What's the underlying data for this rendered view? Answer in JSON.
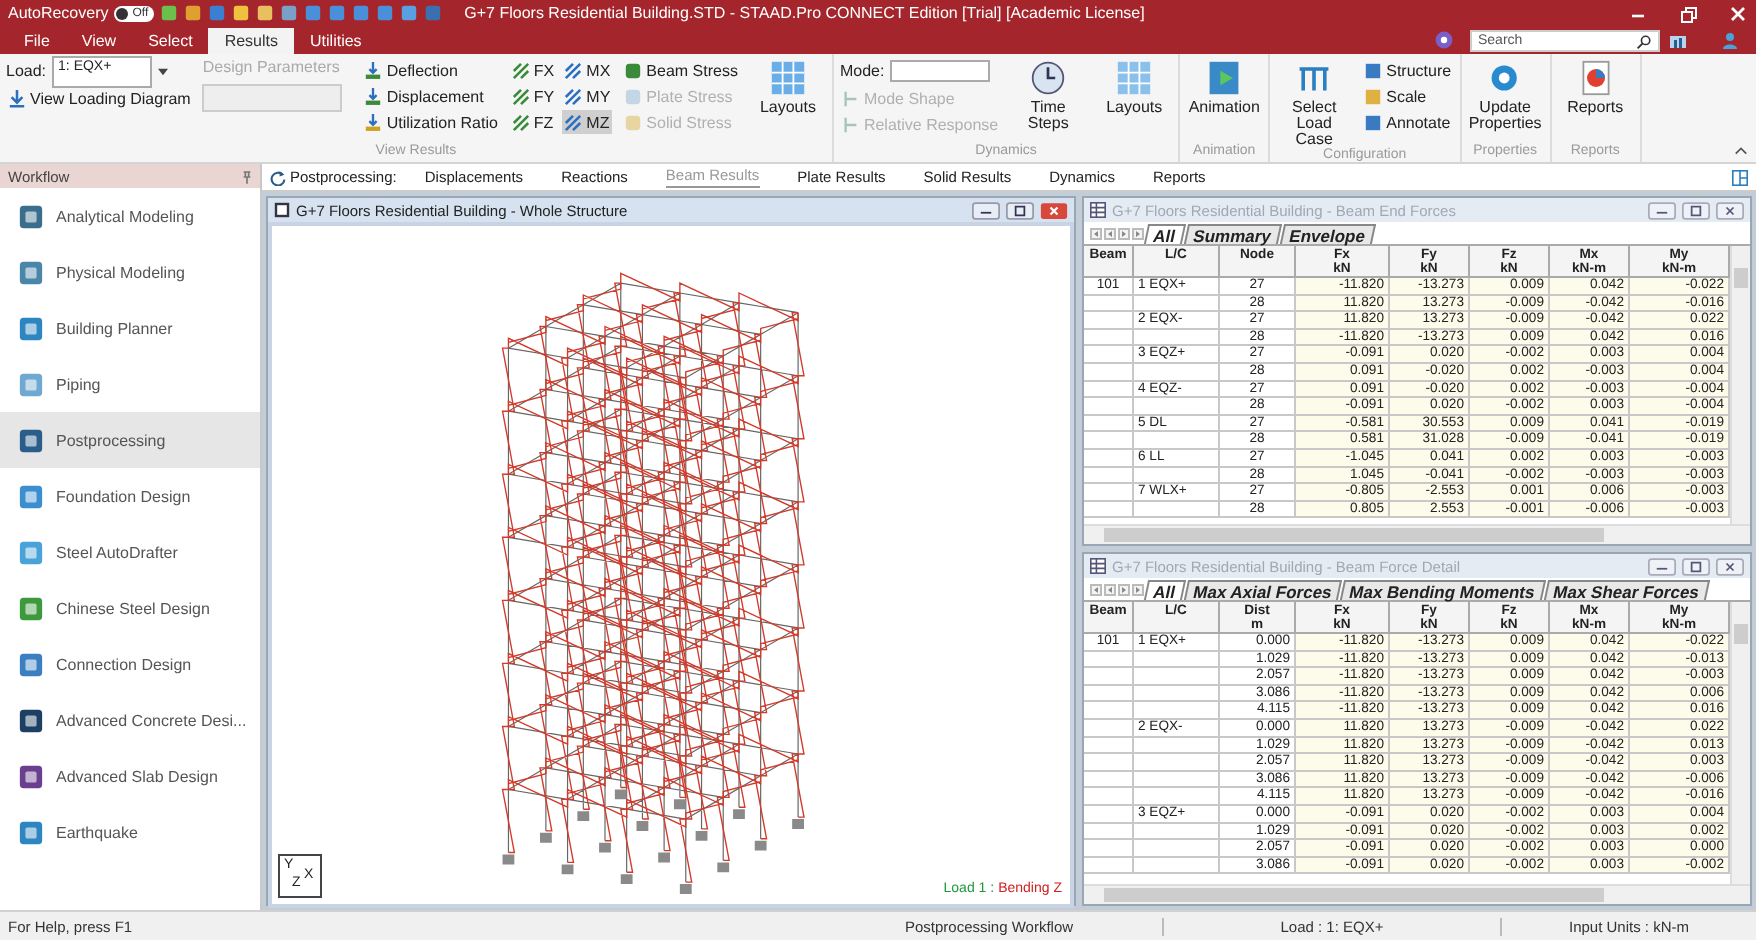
{
  "title_bar": {
    "autorecovery": {
      "label": "AutoRecovery",
      "toggle_text": "Off",
      "on": false
    },
    "title": "G+7 Floors Residential Building.STD - STAAD.Pro CONNECT Edition [Trial] [Academic License]"
  },
  "menu_tabs": [
    {
      "label": "File",
      "selected": false
    },
    {
      "label": "View",
      "selected": false
    },
    {
      "label": "Select",
      "selected": false
    },
    {
      "label": "Results",
      "selected": true
    },
    {
      "label": "Utilities",
      "selected": false
    }
  ],
  "search": {
    "placeholder": "Search"
  },
  "ribbon": {
    "view_results": {
      "label": "View Results",
      "load_label": "Load:",
      "load_value": "1: EQX+",
      "view_loading_diagram": "View Loading Diagram",
      "design_parameters": {
        "label": "Design Parameters",
        "disabled": true
      },
      "result_types": [
        "Deflection",
        "Displacement",
        "Utilization Ratio"
      ],
      "forces": [
        {
          "label": "FX",
          "selected": false
        },
        {
          "label": "MX",
          "selected": false
        },
        {
          "label": "FY",
          "selected": false
        },
        {
          "label": "MY",
          "selected": false
        },
        {
          "label": "FZ",
          "selected": false
        },
        {
          "label": "MZ",
          "selected": true
        }
      ],
      "stresses": [
        {
          "label": "Beam Stress",
          "disabled": false
        },
        {
          "label": "Plate Stress",
          "disabled": true
        },
        {
          "label": "Solid Stress",
          "disabled": true
        }
      ],
      "layouts": "Layouts"
    },
    "dynamics": {
      "label": "Dynamics",
      "mode_label": "Mode:",
      "options": [
        {
          "label": "Mode Shape",
          "disabled": true
        },
        {
          "label": "Relative Response",
          "disabled": true
        }
      ],
      "time_steps": "Time Steps",
      "layouts": "Layouts"
    },
    "animation": {
      "label": "Animation",
      "button": "Animation"
    },
    "configuration": {
      "label": "Configuration",
      "select_load_case": "Select Load Case",
      "items": [
        "Structure",
        "Scale",
        "Annotate"
      ]
    },
    "properties": {
      "label": "Properties",
      "button": "Update Properties"
    },
    "reports": {
      "label": "Reports",
      "button": "Reports"
    }
  },
  "workflow": {
    "title": "Workflow",
    "items": [
      {
        "label": "Analytical Modeling",
        "selected": false,
        "color": "#3a6e8c"
      },
      {
        "label": "Physical Modeling",
        "selected": false,
        "color": "#4a86a8"
      },
      {
        "label": "Building Planner",
        "selected": false,
        "color": "#2e86c1"
      },
      {
        "label": "Piping",
        "selected": false,
        "color": "#6fa8d0"
      },
      {
        "label": "Postprocessing",
        "selected": true,
        "color": "#2a5d8a"
      },
      {
        "label": "Foundation Design",
        "selected": false,
        "color": "#3b8fd0"
      },
      {
        "label": "Steel AutoDrafter",
        "selected": false,
        "color": "#4aa3d8"
      },
      {
        "label": "Chinese Steel Design",
        "selected": false,
        "color": "#3c9a3c"
      },
      {
        "label": "Connection Design",
        "selected": false,
        "color": "#3b7fc0"
      },
      {
        "label": "Advanced Concrete Desi...",
        "selected": false,
        "color": "#1c3f63"
      },
      {
        "label": "Advanced Slab Design",
        "selected": false,
        "color": "#6b3f8f"
      },
      {
        "label": "Earthquake",
        "selected": false,
        "color": "#2e86c1"
      }
    ]
  },
  "result_tabs": {
    "label": "Postprocessing:",
    "tabs": [
      {
        "label": "Displacements",
        "selected": false
      },
      {
        "label": "Reactions",
        "selected": false
      },
      {
        "label": "Beam Results",
        "selected": true
      },
      {
        "label": "Plate Results",
        "selected": false
      },
      {
        "label": "Solid Results",
        "selected": false
      },
      {
        "label": "Dynamics",
        "selected": false
      },
      {
        "label": "Reports",
        "selected": false
      }
    ]
  },
  "structure_window": {
    "title": "G+7 Floors Residential Building - Whole Structure",
    "axes": [
      "Y",
      "Z",
      "X"
    ],
    "load": "Load 1 :",
    "result": "Bending Z"
  },
  "end_forces": {
    "title": "G+7 Floors Residential Building - Beam End Forces",
    "tabs": [
      {
        "label": "All",
        "selected": true
      },
      {
        "label": "Summary",
        "selected": false
      },
      {
        "label": "Envelope",
        "selected": false
      }
    ],
    "columns": [
      {
        "name": "Beam"
      },
      {
        "name": "L/C"
      },
      {
        "name": "Node"
      },
      {
        "name": "Fx",
        "unit": "kN"
      },
      {
        "name": "Fy",
        "unit": "kN"
      },
      {
        "name": "Fz",
        "unit": "kN"
      },
      {
        "name": "Mx",
        "unit": "kN-m"
      },
      {
        "name": "My",
        "unit": "kN-m"
      }
    ],
    "rows": [
      {
        "beam": "101",
        "lc": "1 EQX+",
        "values": [
          "27",
          "-11.820",
          "-13.273",
          "0.009",
          "0.042",
          "-0.022"
        ]
      },
      {
        "values": [
          "28",
          "11.820",
          "13.273",
          "-0.009",
          "-0.042",
          "-0.016"
        ]
      },
      {
        "lc": "2 EQX-",
        "values": [
          "27",
          "11.820",
          "13.273",
          "-0.009",
          "-0.042",
          "0.022"
        ]
      },
      {
        "values": [
          "28",
          "-11.820",
          "-13.273",
          "0.009",
          "0.042",
          "0.016"
        ]
      },
      {
        "lc": "3 EQZ+",
        "values": [
          "27",
          "-0.091",
          "0.020",
          "-0.002",
          "0.003",
          "0.004"
        ]
      },
      {
        "values": [
          "28",
          "0.091",
          "-0.020",
          "0.002",
          "-0.003",
          "0.004"
        ]
      },
      {
        "lc": "4 EQZ-",
        "values": [
          "27",
          "0.091",
          "-0.020",
          "0.002",
          "-0.003",
          "-0.004"
        ]
      },
      {
        "values": [
          "28",
          "-0.091",
          "0.020",
          "-0.002",
          "0.003",
          "-0.004"
        ]
      },
      {
        "lc": "5 DL",
        "values": [
          "27",
          "-0.581",
          "30.553",
          "0.009",
          "0.041",
          "-0.019"
        ]
      },
      {
        "values": [
          "28",
          "0.581",
          "31.028",
          "-0.009",
          "-0.041",
          "-0.019"
        ]
      },
      {
        "lc": "6 LL",
        "values": [
          "27",
          "-1.045",
          "0.041",
          "0.002",
          "0.003",
          "-0.003"
        ]
      },
      {
        "values": [
          "28",
          "1.045",
          "-0.041",
          "-0.002",
          "-0.003",
          "-0.003"
        ]
      },
      {
        "lc": "7 WLX+",
        "values": [
          "27",
          "-0.805",
          "-2.553",
          "0.001",
          "0.006",
          "-0.003"
        ]
      },
      {
        "values": [
          "28",
          "0.805",
          "2.553",
          "-0.001",
          "-0.006",
          "-0.003"
        ]
      }
    ]
  },
  "force_detail": {
    "title": "G+7 Floors Residential Building - Beam Force Detail",
    "tabs": [
      {
        "label": "All",
        "selected": true
      },
      {
        "label": "Max Axial Forces",
        "selected": false
      },
      {
        "label": "Max Bending Moments",
        "selected": false
      },
      {
        "label": "Max Shear Forces",
        "selected": false
      }
    ],
    "columns": [
      {
        "name": "Beam"
      },
      {
        "name": "L/C"
      },
      {
        "name": "Dist",
        "unit": "m"
      },
      {
        "name": "Fx",
        "unit": "kN"
      },
      {
        "name": "Fy",
        "unit": "kN"
      },
      {
        "name": "Fz",
        "unit": "kN"
      },
      {
        "name": "Mx",
        "unit": "kN-m"
      },
      {
        "name": "My",
        "unit": "kN-m"
      }
    ],
    "rows": [
      {
        "beam": "101",
        "lc": "1 EQX+",
        "values": [
          "0.000",
          "-11.820",
          "-13.273",
          "0.009",
          "0.042",
          "-0.022"
        ]
      },
      {
        "values": [
          "1.029",
          "-11.820",
          "-13.273",
          "0.009",
          "0.042",
          "-0.013"
        ]
      },
      {
        "values": [
          "2.057",
          "-11.820",
          "-13.273",
          "0.009",
          "0.042",
          "-0.003"
        ]
      },
      {
        "values": [
          "3.086",
          "-11.820",
          "-13.273",
          "0.009",
          "0.042",
          "0.006"
        ]
      },
      {
        "values": [
          "4.115",
          "-11.820",
          "-13.273",
          "0.009",
          "0.042",
          "0.016"
        ]
      },
      {
        "lc": "2 EQX-",
        "values": [
          "0.000",
          "11.820",
          "13.273",
          "-0.009",
          "-0.042",
          "0.022"
        ]
      },
      {
        "values": [
          "1.029",
          "11.820",
          "13.273",
          "-0.009",
          "-0.042",
          "0.013"
        ]
      },
      {
        "values": [
          "2.057",
          "11.820",
          "13.273",
          "-0.009",
          "-0.042",
          "0.003"
        ]
      },
      {
        "values": [
          "3.086",
          "11.820",
          "13.273",
          "-0.009",
          "-0.042",
          "-0.006"
        ]
      },
      {
        "values": [
          "4.115",
          "11.820",
          "13.273",
          "-0.009",
          "-0.042",
          "-0.016"
        ]
      },
      {
        "lc": "3 EQZ+",
        "values": [
          "0.000",
          "-0.091",
          "0.020",
          "-0.002",
          "0.003",
          "0.004"
        ]
      },
      {
        "values": [
          "1.029",
          "-0.091",
          "0.020",
          "-0.002",
          "0.003",
          "0.002"
        ]
      },
      {
        "values": [
          "2.057",
          "-0.091",
          "0.020",
          "-0.002",
          "0.003",
          "0.000"
        ]
      },
      {
        "values": [
          "3.086",
          "-0.091",
          "0.020",
          "-0.002",
          "0.003",
          "-0.002"
        ]
      }
    ]
  },
  "status_bar": [
    "For Help, press F1",
    "Postprocessing Workflow",
    "Load : 1: EQX+",
    "Input Units : kN-m"
  ]
}
